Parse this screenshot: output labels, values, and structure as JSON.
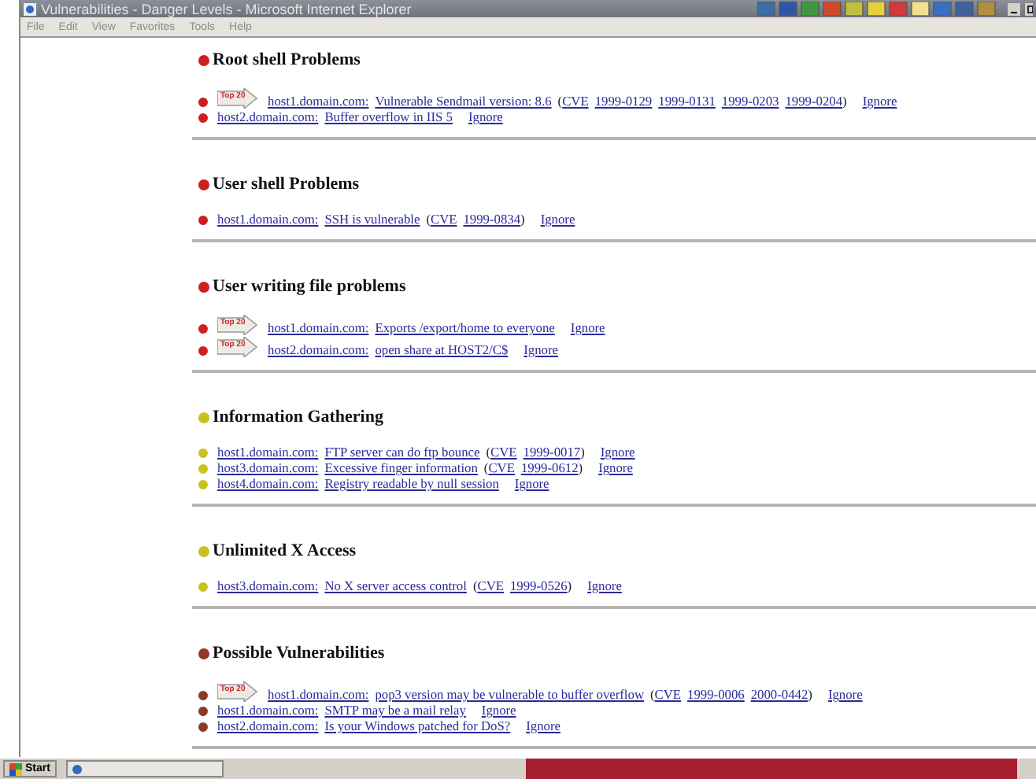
{
  "window": {
    "title": "Vulnerabilities - Danger Levels - Microsoft Internet Explorer"
  },
  "menu": [
    "File",
    "Edit",
    "View",
    "Favorites",
    "Tools",
    "Help"
  ],
  "sections": [
    {
      "title": "Root shell Problems",
      "color": "#cc1f1f",
      "items": [
        {
          "badge": "Top 20",
          "host": "host1.domain.com:",
          "description": "Vulnerable Sendmail version: 8.6",
          "cve": {
            "open": "(",
            "label": "CVE",
            "ids": [
              "1999-0129",
              "1999-0131",
              "1999-0203",
              "1999-0204"
            ],
            "close": ")"
          },
          "ignore": "Ignore"
        },
        {
          "host": "host2.domain.com:",
          "description": "Buffer overflow in IIS 5",
          "ignore": "Ignore"
        }
      ]
    },
    {
      "title": "User shell Problems",
      "color": "#cc1f1f",
      "items": [
        {
          "host": "host1.domain.com:",
          "description": "SSH is vulnerable",
          "cve": {
            "open": "(",
            "label": "CVE",
            "ids": [
              "1999-0834"
            ],
            "close": ")"
          },
          "ignore": "Ignore"
        }
      ]
    },
    {
      "title": "User writing file problems",
      "color": "#cc1f1f",
      "items": [
        {
          "badge": "Top 20",
          "host": "host1.domain.com:",
          "description": "Exports /export/home to everyone",
          "ignore": "Ignore"
        },
        {
          "badge": "Top 20",
          "host": "host2.domain.com:",
          "description": "open share at HOST2/C$",
          "ignore": "Ignore"
        }
      ]
    },
    {
      "title": "Information Gathering",
      "color": "#c9c21e",
      "items": [
        {
          "host": "host1.domain.com:",
          "description": "FTP server can do ftp bounce",
          "cve": {
            "open": "(",
            "label": "CVE",
            "ids": [
              "1999-0017"
            ],
            "close": ")"
          },
          "ignore": "Ignore"
        },
        {
          "host": "host3.domain.com:",
          "description": "Excessive finger information",
          "cve": {
            "open": "(",
            "label": "CVE",
            "ids": [
              "1999-0612"
            ],
            "close": ")"
          },
          "ignore": "Ignore"
        },
        {
          "host": "host4.domain.com:",
          "description": "Registry readable by null session",
          "ignore": "Ignore"
        }
      ]
    },
    {
      "title": "Unlimited X Access",
      "color": "#c9c21e",
      "items": [
        {
          "host": "host3.domain.com:",
          "description": "No X server access control",
          "cve": {
            "open": "(",
            "label": "CVE",
            "ids": [
              "1999-0526"
            ],
            "close": ")"
          },
          "ignore": "Ignore"
        }
      ]
    },
    {
      "title": "Possible Vulnerabilities",
      "color": "#8c3a26",
      "items": [
        {
          "badge": "Top 20",
          "host": "host1.domain.com:",
          "description": "pop3 version may be vulnerable to buffer overflow",
          "cve": {
            "open": "(",
            "label": "CVE",
            "ids": [
              "1999-0006",
              "2000-0442"
            ],
            "close": ")"
          },
          "ignore": "Ignore"
        },
        {
          "host": "host1.domain.com:",
          "description": "SMTP may be a mail relay",
          "ignore": "Ignore"
        },
        {
          "host": "host2.domain.com:",
          "description": "Is your Windows patched for DoS?",
          "ignore": "Ignore"
        }
      ]
    }
  ],
  "taskbar": {
    "start": "Start"
  }
}
